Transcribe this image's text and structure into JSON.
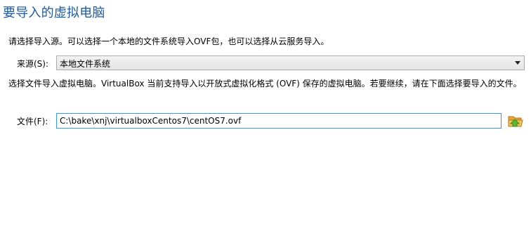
{
  "page": {
    "title": "要导入的虚拟电脑",
    "intro": "请选择导入源。可以选择一个本地的文件系统导入OVF包，也可以选择从云服务导入。"
  },
  "source": {
    "label": "来源(S):",
    "value": "本地文件系统"
  },
  "description": "选择文件导入虚拟电脑。VirtualBox 当前支持导入以开放式虚拟化格式 (OVF) 保存的虚拟电脑。若要继续，请在下面选择要导入的文件。",
  "file": {
    "label": "文件(F):",
    "value": "C:\\bake\\xnj\\virtualboxCentos7\\centOS7.ovf"
  },
  "icons": {
    "dropdown": "chevron-down-icon",
    "browse": "folder-open-icon"
  },
  "colors": {
    "title": "#1c5aa6",
    "input_focus_border": "#3399ff",
    "folder": "#e8a33c",
    "folder_arrow": "#5cb82f"
  }
}
